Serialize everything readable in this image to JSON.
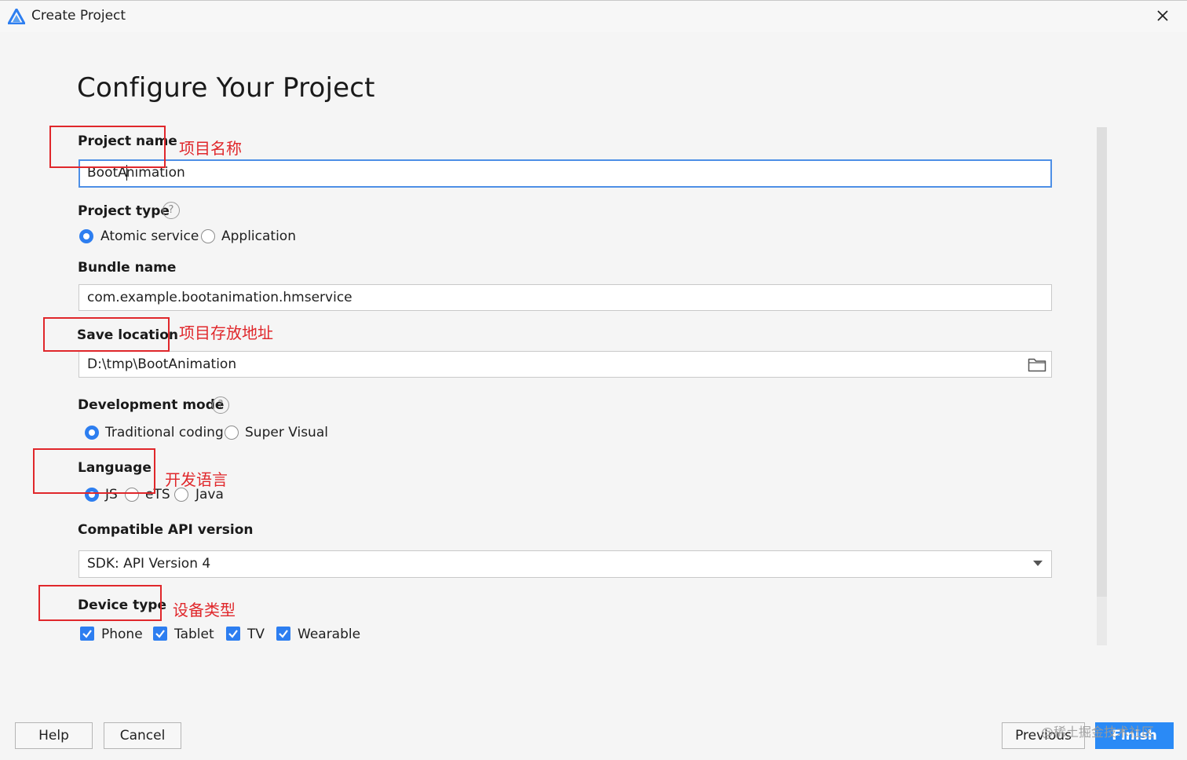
{
  "window": {
    "title": "Create Project"
  },
  "heading": "Configure Your Project",
  "project_name": {
    "label": "Project name",
    "value_before_caret": "BootA",
    "value_after_caret": "nimation"
  },
  "project_type": {
    "label": "Project type",
    "options": [
      {
        "label": "Atomic service",
        "checked": true
      },
      {
        "label": "Application",
        "checked": false
      }
    ]
  },
  "bundle_name": {
    "label": "Bundle name",
    "value": "com.example.bootanimation.hmservice"
  },
  "save_location": {
    "label": "Save location",
    "value": "D:\\tmp\\BootAnimation"
  },
  "development_mode": {
    "label": "Development mode",
    "options": [
      {
        "label": "Traditional coding",
        "checked": true
      },
      {
        "label": "Super Visual",
        "checked": false
      }
    ]
  },
  "language": {
    "label": "Language",
    "options": [
      {
        "label": "JS",
        "checked": true
      },
      {
        "label": "eTS",
        "checked": false
      },
      {
        "label": "Java",
        "checked": false
      }
    ]
  },
  "api_version": {
    "label": "Compatible API version",
    "value": "SDK: API Version 4"
  },
  "device_type": {
    "label": "Device type",
    "options": [
      {
        "label": "Phone",
        "checked": true
      },
      {
        "label": "Tablet",
        "checked": true
      },
      {
        "label": "TV",
        "checked": true
      },
      {
        "label": "Wearable",
        "checked": true
      }
    ]
  },
  "annotations": {
    "project_name": "项目名称",
    "save_location": "项目存放地址",
    "language": "开发语言",
    "device_type": "设备类型"
  },
  "buttons": {
    "help": "Help",
    "cancel": "Cancel",
    "previous": "Previous",
    "finish": "Finish"
  },
  "watermark": "@稀土掘金技术社区",
  "icons": {
    "help": "?",
    "close": "close-icon",
    "folder": "folder-icon",
    "dropdown": "chevron-down-icon"
  },
  "colors": {
    "accent": "#2d7ef0",
    "annotation": "#e0272b",
    "primary_button": "#2a8af6"
  }
}
